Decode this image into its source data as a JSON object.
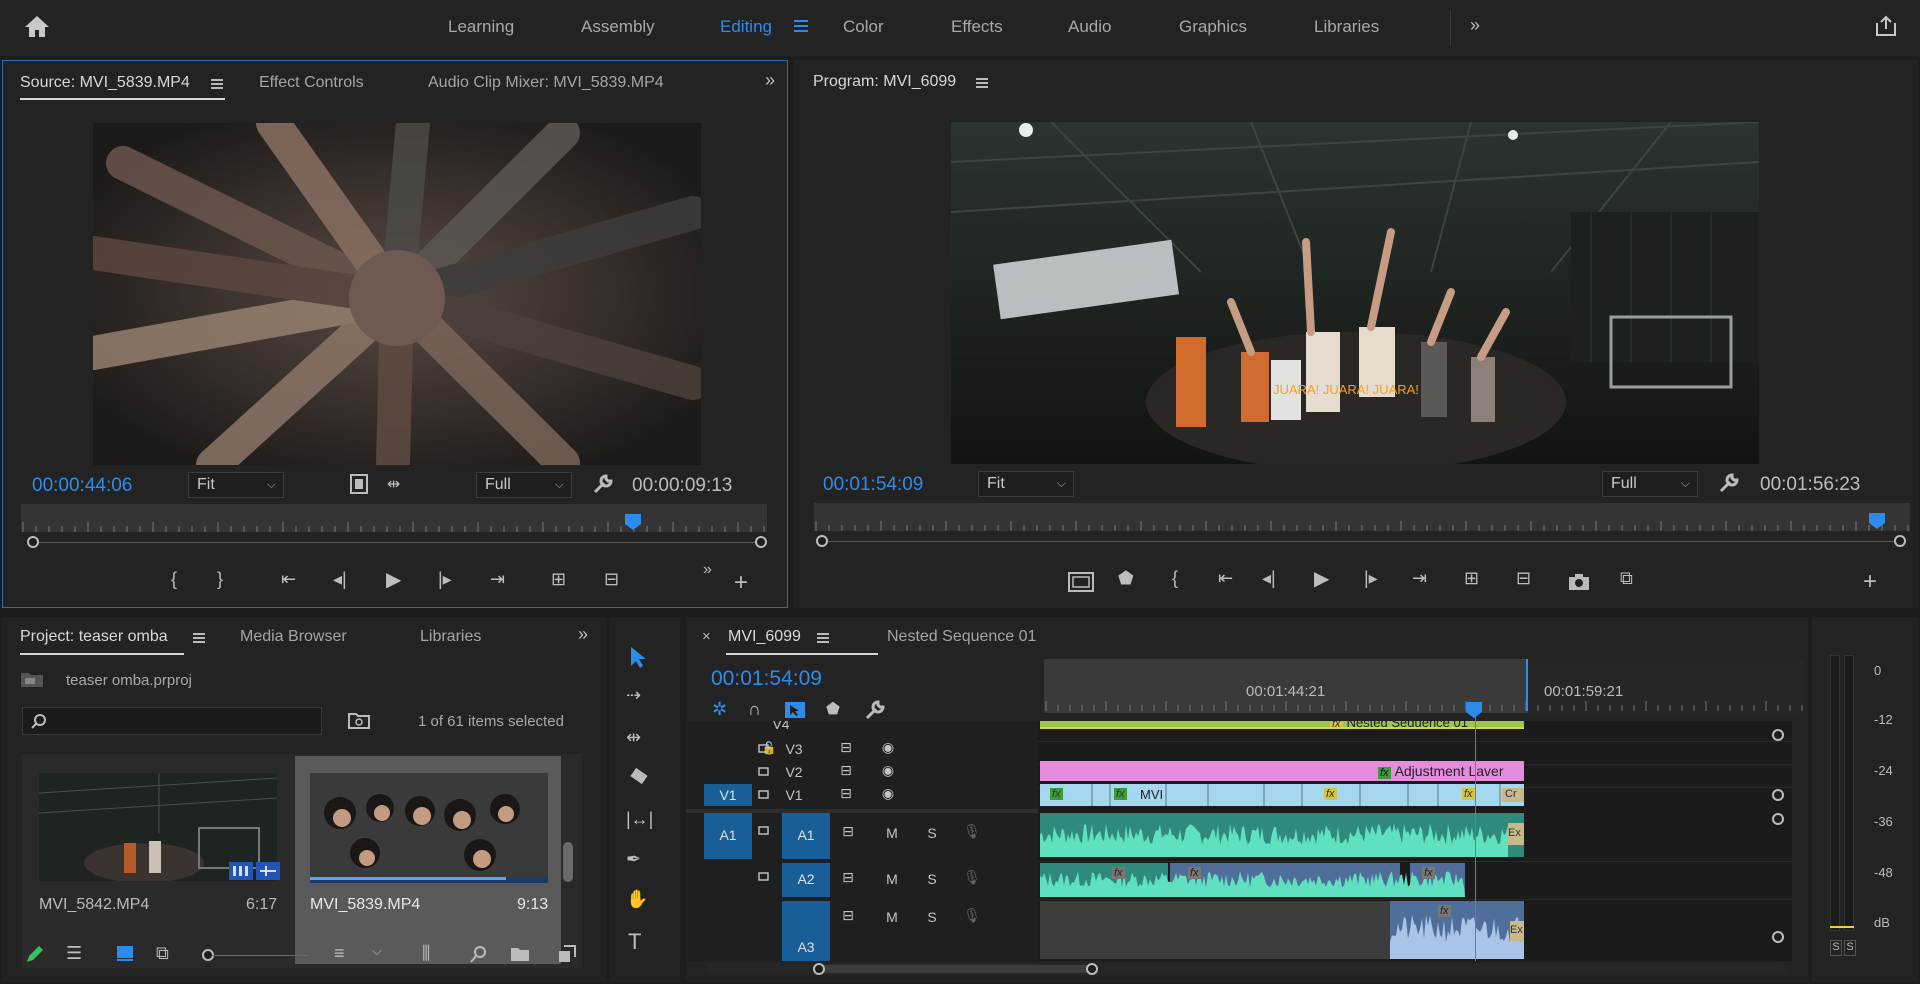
{
  "workspace": {
    "tabs": [
      "Learning",
      "Assembly",
      "Editing",
      "Color",
      "Effects",
      "Audio",
      "Graphics",
      "Libraries"
    ],
    "active": "Editing"
  },
  "source": {
    "tabs": [
      "Source: MVI_5839.MP4",
      "Effect Controls",
      "Audio Clip Mixer: MVI_5839.MP4"
    ],
    "timecode": "00:00:44:06",
    "fit": "Fit",
    "resolution": "Full",
    "duration": "00:00:09:13",
    "playhead_fraction": 0.82
  },
  "program": {
    "title": "Program: MVI_6099",
    "timecode": "00:01:54:09",
    "fit": "Fit",
    "resolution": "Full",
    "duration": "00:01:56:23",
    "caption": "JUARA! JUARA! JUARA!",
    "playhead_fraction": 0.97
  },
  "project": {
    "tabs": [
      "Project: teaser omba",
      "Media Browser",
      "Libraries"
    ],
    "file": "teaser omba.prproj",
    "search_placeholder": "",
    "selection": "1 of 61 items selected",
    "items": [
      {
        "name": "MVI_5842.MP4",
        "duration": "6:17"
      },
      {
        "name": "MVI_5839.MP4",
        "duration": "9:13"
      }
    ]
  },
  "timeline": {
    "tabs": [
      "MVI_6099",
      "Nested Sequence 01"
    ],
    "close": "×",
    "timecode": "00:01:54:09",
    "ruler": [
      "00:01:44:21",
      "00:01:59:21"
    ],
    "video_tracks": [
      "V4",
      "V3",
      "V2",
      "V1"
    ],
    "audio_tracks": [
      "A1",
      "A2",
      "A3"
    ],
    "source_patch_v": "V1",
    "source_patch_a": "A1",
    "track_mute": "M",
    "track_solo": "S",
    "clips": {
      "nested": "Nested Sequence 01",
      "adjustment": "Adjustment Laver",
      "mvi": "MVI",
      "fx": "fx",
      "cr": "Cr",
      "ex": "Ex"
    }
  },
  "meter": {
    "scale": [
      "0",
      "-12",
      "-24",
      "-36",
      "-48",
      "dB"
    ],
    "solo": [
      "S",
      "S"
    ]
  },
  "colors": {
    "accent": "#2d8ceb",
    "video_clip": "#a5d8ef",
    "audio_clip": "#43c7a5",
    "adjustment": "#e58cdf",
    "nested": "#99c64f"
  }
}
